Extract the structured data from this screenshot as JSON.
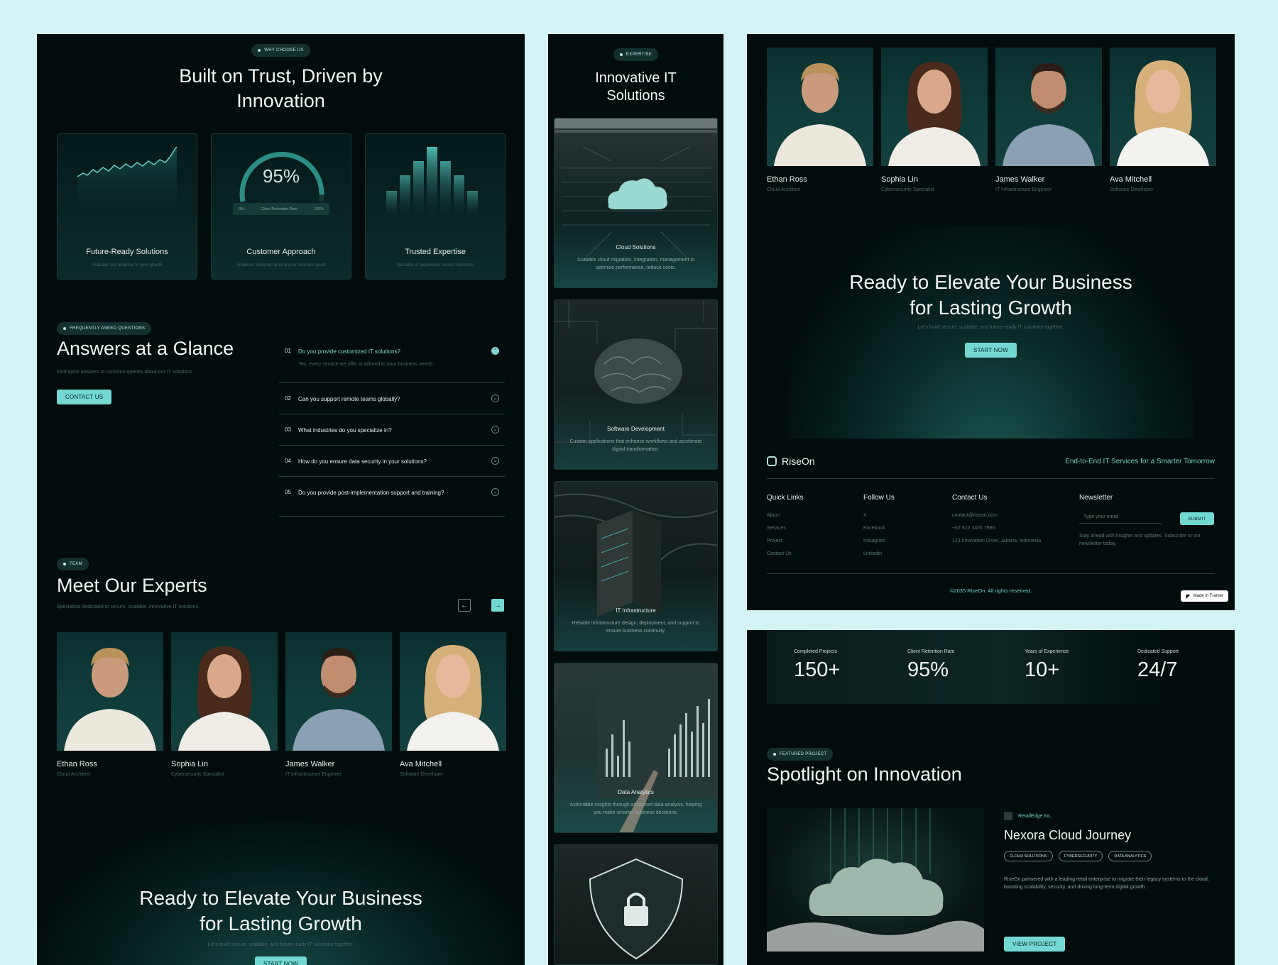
{
  "why": {
    "pill": "WHY CHOOSE US",
    "title_line1": "Built on Trust, Driven by",
    "title_line2": "Innovation",
    "cards": [
      {
        "title": "Future-Ready Solutions",
        "subtitle": "Scalable and adaptive to your growth"
      },
      {
        "title": "Customer Approach",
        "subtitle": "Solutions designed around your business goals",
        "gauge_value": "95%",
        "gauge_label": "Client Retention Rate",
        "gauge_min": "0%",
        "gauge_max": "100%",
        "gauge_fraction": 0.95
      },
      {
        "title": "Trusted Expertise",
        "subtitle": "Decades of experience across industries"
      }
    ]
  },
  "faq": {
    "pill": "FREQUENTLY ASKED QUESTIONS",
    "title": "Answers at a Glance",
    "subtitle": "Find quick answers to common queries about our IT solutions.",
    "contact_label": "CONTACT US",
    "items": [
      {
        "num": "01",
        "q": "Do you provide customized IT solutions?",
        "a": "Yes, every service we offer is tailored to your business needs.",
        "open": true
      },
      {
        "num": "02",
        "q": "Can you support remote teams globally?"
      },
      {
        "num": "03",
        "q": "What industries do you specialize in?"
      },
      {
        "num": "04",
        "q": "How do you ensure data security in your solutions?"
      },
      {
        "num": "05",
        "q": "Do you provide post-implementation support and training?"
      }
    ]
  },
  "team": {
    "pill": "TEAM",
    "title": "Meet Our Experts",
    "subtitle": "Specialists dedicated to secure, scalable, innovative IT solutions.",
    "members": [
      {
        "name": "Ethan Ross",
        "role": "Cloud Architect"
      },
      {
        "name": "Sophia Lin",
        "role": "Cybersecurity Specialist"
      },
      {
        "name": "James Walker",
        "role": "IT Infrastructure Engineer"
      },
      {
        "name": "Ava Mitchell",
        "role": "Software Developer"
      }
    ]
  },
  "cta": {
    "title_line1": "Ready to Elevate Your Business",
    "title_line2": "for Lasting Growth",
    "subtitle": "Let's build secure, scalable, and future-ready IT solutions together.",
    "button": "START NOW"
  },
  "expertise": {
    "pill": "EXPERTISE",
    "title_line1": "Innovative IT",
    "title_line2": "Solutions",
    "services": [
      {
        "title": "Cloud Solutions",
        "desc": "Scalable cloud migration, integration, management to optimize performance, reduce costs."
      },
      {
        "title": "Software Development",
        "desc": "Custom applications that enhance workflows and accelerate digital transformation."
      },
      {
        "title": "IT Infrastructure",
        "desc": "Reliable infrastructure design, deployment, and support to ensure business continuity."
      },
      {
        "title": "Data Analytics",
        "desc": "Actionable insights through advanced data analysis, helping you make smarter business decisions."
      }
    ]
  },
  "footer": {
    "brand": "RiseOn",
    "tagline": "End-to-End IT Services for a Smarter Tomorrow",
    "quick_links_title": "Quick Links",
    "quick_links": [
      "About",
      "Services",
      "Project",
      "Contact Us"
    ],
    "follow_title": "Follow Us",
    "follow_links": [
      "X",
      "Facebook",
      "Instagram",
      "Linkedin"
    ],
    "contact_title": "Contact Us",
    "contact_lines": [
      "contact@riseon.com",
      "+62 812 3456 7890",
      "123 Innovation Drive, Jakarta, Indonesia"
    ],
    "newsletter_title": "Newsletter",
    "newsletter_placeholder": "Type your email",
    "submit": "SUBMIT",
    "newsletter_note": "Stay ahead with insights and updates. Subscribe to our newsletter today.",
    "copyright": "©2035 RiseOn. All rights reserved.",
    "framer_badge": "Made in Framer"
  },
  "stats": [
    {
      "label": "Completed Projects",
      "value": "150+"
    },
    {
      "label": "Client Retention Rate",
      "value": "95%"
    },
    {
      "label": "Years of Experience",
      "value": "10+"
    },
    {
      "label": "Dedicated Support",
      "value": "24/7"
    }
  ],
  "project": {
    "pill": "FEATURED PROJECT",
    "title": "Spotlight on Innovation",
    "client": "RetailEdge Inc.",
    "name": "Nexora Cloud Journey",
    "tags": [
      "CLOUD SOLUTIONS",
      "CYBERSECURITY",
      "DATA ANALYTICS"
    ],
    "desc": "RiseOn partnered with a leading retail enterprise to migrate their legacy systems to the cloud, boosting scalability, security, and driving long-term digital growth.",
    "button": "VIEW PROJECT"
  },
  "colors": {
    "accent": "#74d8d2",
    "panel": "#020c0c",
    "page_bg": "#d3f3f5"
  }
}
